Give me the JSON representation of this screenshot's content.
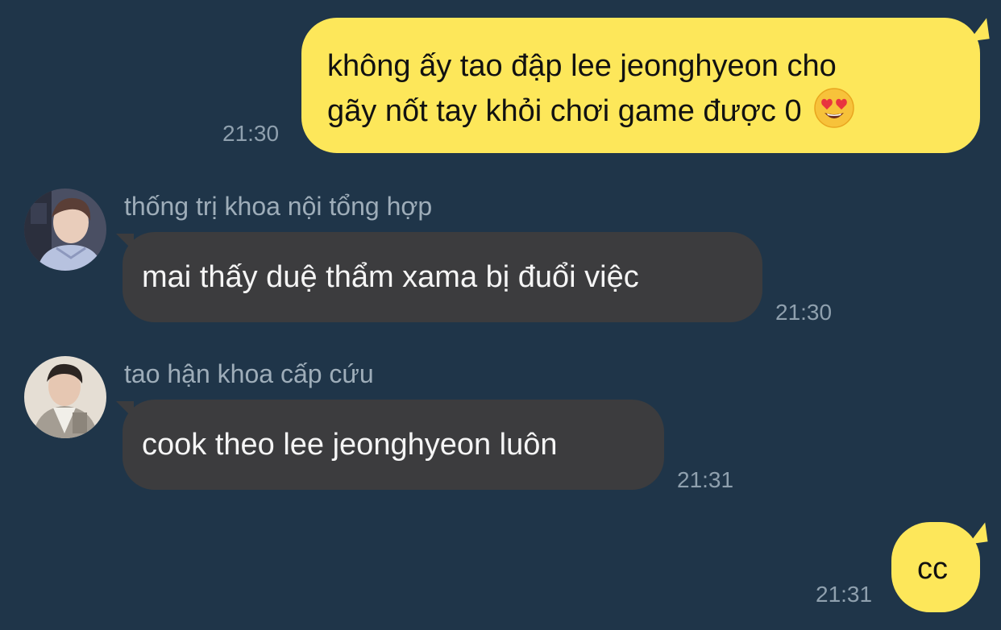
{
  "messages": [
    {
      "direction": "outgoing",
      "line1": "không ấy tao đập lee jeonghyeon cho",
      "line2": "gãy nốt tay khỏi chơi game được 0",
      "emoji": "smiling-face-with-heart-eyes",
      "time": "21:30"
    },
    {
      "direction": "incoming",
      "sender": "thống trị khoa nội tổng hợp",
      "text": "mai thấy duệ thẩm xama bị đuổi việc",
      "time": "21:30"
    },
    {
      "direction": "incoming",
      "sender": "tao hận khoa cấp cứu",
      "text": "cook theo lee jeonghyeon luôn",
      "time": "21:31"
    },
    {
      "direction": "outgoing",
      "text": "cc",
      "time": "21:31"
    }
  ],
  "colors": {
    "background": "#1f3549",
    "outgoing_bubble": "#fde75a",
    "incoming_bubble": "#3c3c3e",
    "timestamp": "#8fa0ae",
    "sender_name": "#9eadb9"
  }
}
